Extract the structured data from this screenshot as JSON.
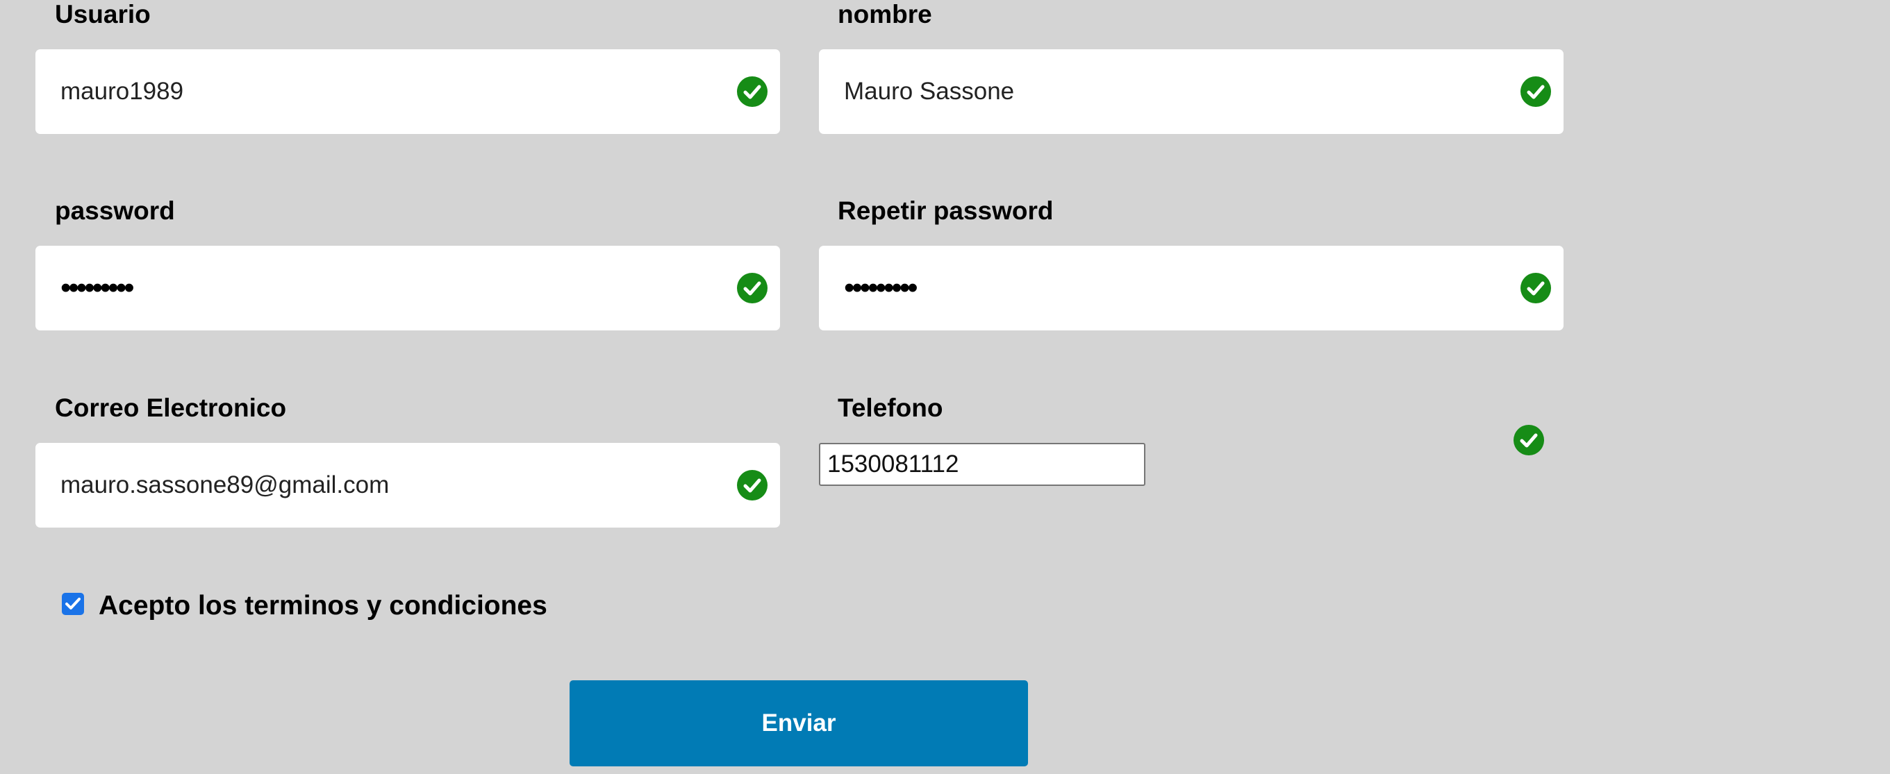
{
  "form": {
    "usuario": {
      "label": "Usuario",
      "value": "mauro1989",
      "status_icon": "check-circle-icon"
    },
    "nombre": {
      "label": "nombre",
      "value": "Mauro Sassone",
      "status_icon": "check-circle-icon"
    },
    "password": {
      "label": "password",
      "value": "•••••••••",
      "status_icon": "check-circle-icon"
    },
    "repetir_password": {
      "label": "Repetir password",
      "value": "•••••••••",
      "status_icon": "check-circle-icon"
    },
    "correo": {
      "label": "Correo Electronico",
      "value": "mauro.sassone89@gmail.com",
      "status_icon": "check-circle-icon"
    },
    "telefono": {
      "label": "Telefono",
      "value": "1530081112",
      "status_icon": "check-circle-icon"
    },
    "terms": {
      "label": "Acepto los terminos y condiciones",
      "checked": true
    },
    "submit_label": "Enviar"
  },
  "colors": {
    "background": "#d4d4d4",
    "valid_icon": "#168c16",
    "submit_button": "#017bb5",
    "checkbox": "#1a73e8"
  }
}
